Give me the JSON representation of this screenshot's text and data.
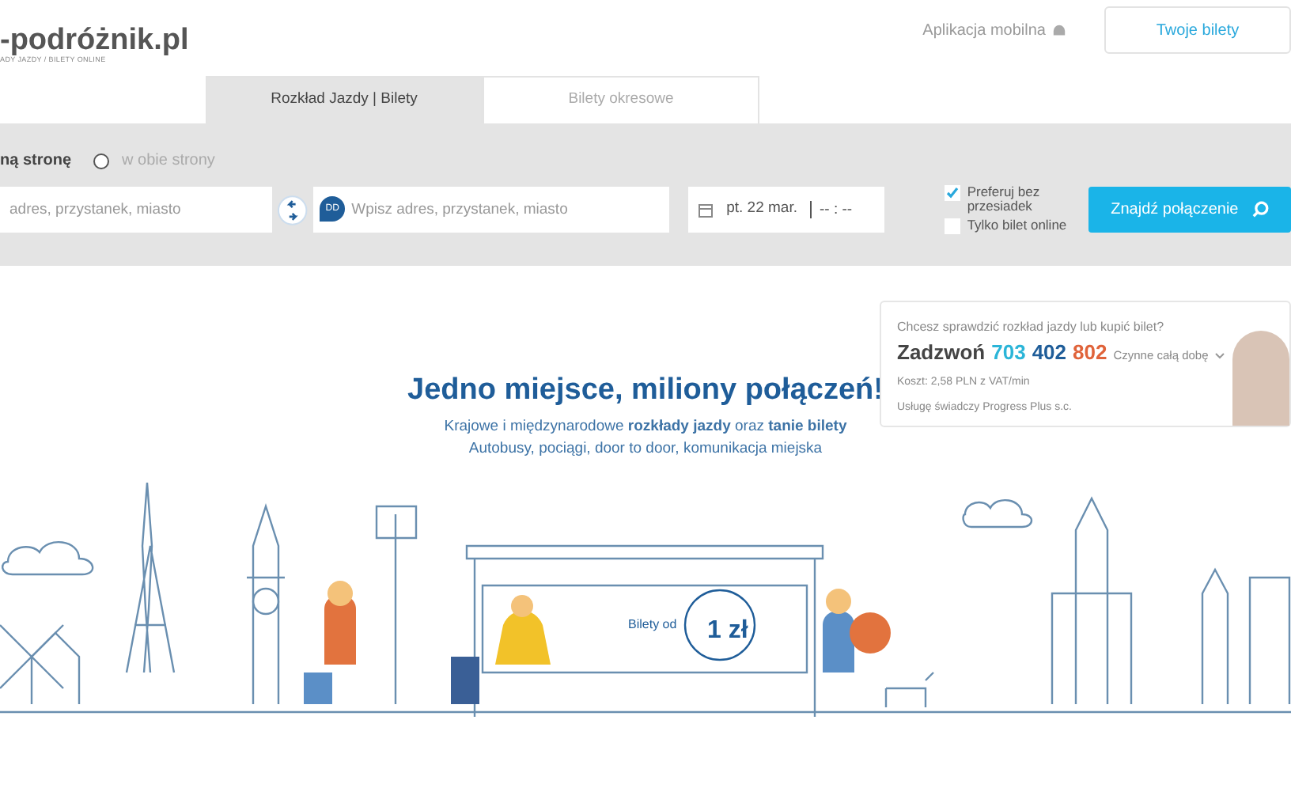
{
  "header": {
    "logo": "-podróżnik.pl",
    "logo_tagline": "ADY JAZDY / BILETY ONLINE",
    "mobile_app": "Aplikacja mobilna",
    "tickets_button": "Twoje bilety"
  },
  "tabs": [
    {
      "label": "Rozkład Jazdy | Bilety",
      "selected": true
    },
    {
      "label": "Bilety okresowe",
      "selected": false
    }
  ],
  "search": {
    "trip_types": [
      {
        "label": "ną stronę",
        "selected": true
      },
      {
        "label": "w obie strony",
        "selected": false
      }
    ],
    "origin": {
      "placeholder": "adres, przystanek, miasto"
    },
    "destination": {
      "placeholder": "Wpisz adres, przystanek, miasto",
      "pin_label": "DD"
    },
    "date": "pt. 22 mar.",
    "time": "-- : --",
    "options": [
      {
        "label": "Preferuj bez przesiadek",
        "checked": true
      },
      {
        "label": "Tylko bilet online",
        "checked": false
      }
    ],
    "submit": "Znajdź połączenie"
  },
  "hotline": {
    "question": "Chcesz sprawdzić rozkład jazdy lub kupić bilet?",
    "call": "Zadzwoń",
    "numbers": [
      {
        "text": "703",
        "color": "#2bb5d8"
      },
      {
        "text": "402",
        "color": "#1f5d99"
      },
      {
        "text": "802",
        "color": "#e0633a"
      }
    ],
    "hours": "Czynne całą dobę",
    "cost": "Koszt: 2,58 PLN z VAT/min",
    "provider": "Usługę świadczy Progress Plus s.c."
  },
  "hero": {
    "title": "Jedno miejsce, miliony połączeń!",
    "subtitle": "Krajowe i międzynarodowe **rozkłady jazdy** oraz **tanie bilety**",
    "subtitle2": "Autobusy, pociągi, door to door, komunikacja miejska",
    "sign_text": "Bilety od",
    "price": "1 zł"
  }
}
